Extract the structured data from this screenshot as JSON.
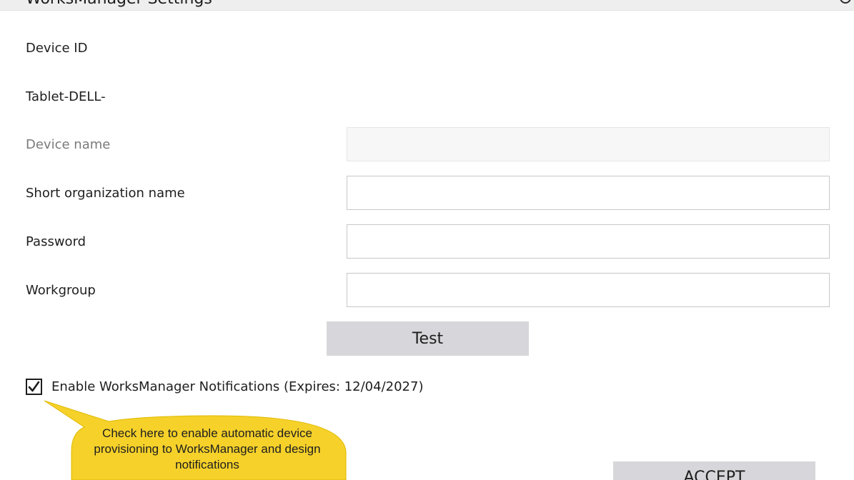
{
  "window": {
    "title": "WorksManager Settings"
  },
  "form": {
    "device_id_label": "Device ID",
    "device_id_value": "Tablet-DELL-",
    "device_name_label": "Device name",
    "device_name_value": "",
    "org_label": "Short organization name",
    "org_value": "",
    "password_label": "Password",
    "password_value": "",
    "workgroup_label": "Workgroup",
    "workgroup_value": ""
  },
  "buttons": {
    "test": "Test",
    "accept": "ACCEPT"
  },
  "notifications": {
    "label": "Enable WorksManager Notifications (Expires: 12/04/2027)",
    "checked": true
  },
  "callout": {
    "text": "Check here to enable automatic device provisioning to WorksManager and design notifications",
    "color": "#f5d12a"
  }
}
